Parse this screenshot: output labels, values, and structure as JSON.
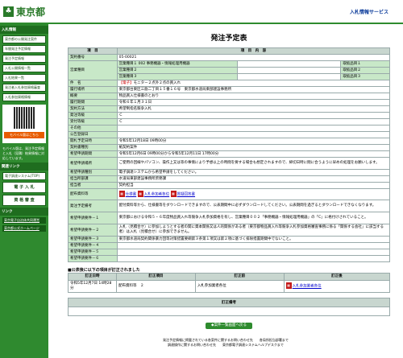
{
  "header": {
    "logo_mark": "♣",
    "logo_text": "東京都",
    "system_title": "入札情報サービス"
  },
  "sidebar": {
    "section_menu": "入札情報",
    "menu_items": [
      "東京都の公開発注案件",
      "年間発注予定情報",
      "発注予定情報",
      "入札公開情報一覧",
      "入札結果一覧",
      "発注者入札参加資格審査",
      "入札参加資格情報"
    ],
    "qr_label": "モバイル版はこちら",
    "mobile_note": "モバイル版は、発注予定情報と入札（見積）結果情報に対応しています。",
    "section_links": "関連リンク",
    "link_items": [
      "電子調達システム(TOP)",
      "電 子 入 札",
      "資 格 審 査"
    ],
    "section_other": "リンク",
    "other_links": [
      "東京電子自治体共同運営",
      "東京都公式ホームページ"
    ]
  },
  "main": {
    "page_title": "発注予定表",
    "head_item": "項　目",
    "head_content": "項　目　内　容",
    "rows": [
      {
        "label": "契約番号",
        "value": "05-00021"
      },
      {
        "label": "営業種目",
        "value": "営業種目１ 002 事務機器・情報処理用機器",
        "extra": "取扱品目１"
      },
      {
        "label": "",
        "value": "営業種目２",
        "extra": "取扱品目２"
      },
      {
        "label": "",
        "value": "営業種目３",
        "extra": "取扱品目３"
      },
      {
        "label": "件　名",
        "value_tag": "【電子】",
        "value": "モニター２点外２点の買入れ"
      },
      {
        "label": "履行場所",
        "value": "東京都台東区三筋二丁目１５番１６号　東京都水道局東部建設事務所"
      },
      {
        "label": "概要",
        "value": "物品買入仕様書のとおり"
      },
      {
        "label": "履行期間",
        "value": "令和６年１月３１日"
      },
      {
        "label": "契約方法",
        "value": "希望制指名競争入札"
      },
      {
        "label": "発注等級",
        "value": "Ｃ"
      },
      {
        "label": "受付等級",
        "value": "Ｃ"
      },
      {
        "label": "その他",
        "value": ""
      },
      {
        "label": "公告登録日",
        "value": ""
      },
      {
        "label": "開札予定日時",
        "value": "令和5年12月18日 09時00分"
      },
      {
        "label": "契約書種別",
        "value": "紙契約案件"
      },
      {
        "label": "希望申請期間",
        "value": "令和5年12月6日 09時00分から令和5年12月11日 17時00分"
      },
      {
        "label": "希望申請場所",
        "value": "ご使用の回線やパソコン、操作上又は等の事情により予想以上の時間を要する場合も想定されますので、締切日時に間に合うように早めの処理をお願いします。"
      },
      {
        "label": "希望申請種別",
        "value": "電子調達システムから希望申請をしてください。"
      },
      {
        "label": "担当所部課",
        "value": "水道局東部建設事務所庶務課"
      },
      {
        "label": "担当者",
        "value": "契約担当"
      },
      {
        "label": "配布資料等",
        "value": ""
      },
      {
        "label": "発注予定備考",
        "value": "配付資料等から、仕様書等をダウンロードできますので、公表期間中に必ずダウンロードしてください。公表期間を過ぎるとダウンロードできなくなります。"
      },
      {
        "label": "希望申請要件－１",
        "value": "東京都における令和５・６年度物品買入れ等競争入札参加資格を有し、営業種目００２「事務機器・情報処理用機器」の「C」に格付けされていること。"
      },
      {
        "label": "希望申請要件－２",
        "value": "入札（見積合せ）に参加しようとする者の関に資本関係又は人的関係がある者（東京都物品買入れ等競争入札参加資格審査事務に係る「関係する会社」に該当する者）は入札（見積合せ）に参加できません。"
      },
      {
        "label": "希望申請要件－３",
        "value": "東京都水道局契約関係暴力団等対策措置要綱第３条第１項又は第２項に基づく排除措置期間中でないこと。"
      },
      {
        "label": "希望申請要件－４",
        "value": ""
      },
      {
        "label": "希望申請要件－５",
        "value": ""
      },
      {
        "label": "希望申請要件－６",
        "value": ""
      }
    ],
    "docs": [
      "仕様書",
      "入札参加者各位",
      "質疑回答書"
    ],
    "history_note": "■公表後に以下の項目が訂正されました",
    "history_headers": [
      "訂正日時",
      "訂正項目",
      "訂正前",
      "訂正後"
    ],
    "history_row": {
      "date": "令和5年12月7日 14時28分",
      "item": "配布資料等　２",
      "before": "入札参加業者各位",
      "after": "入札参加業者各位"
    },
    "remarks_header": "訂正備考",
    "back_button": "◆案件一覧画面へ戻る"
  },
  "footer": {
    "line1": "発注予定情報に掲載されている各案件に関するお問い合わせ先　　各局所担当部署まで",
    "line2": "調達操作に関するお問い合わせ先　　東京都電子調達システムヘルプデスクまで"
  }
}
